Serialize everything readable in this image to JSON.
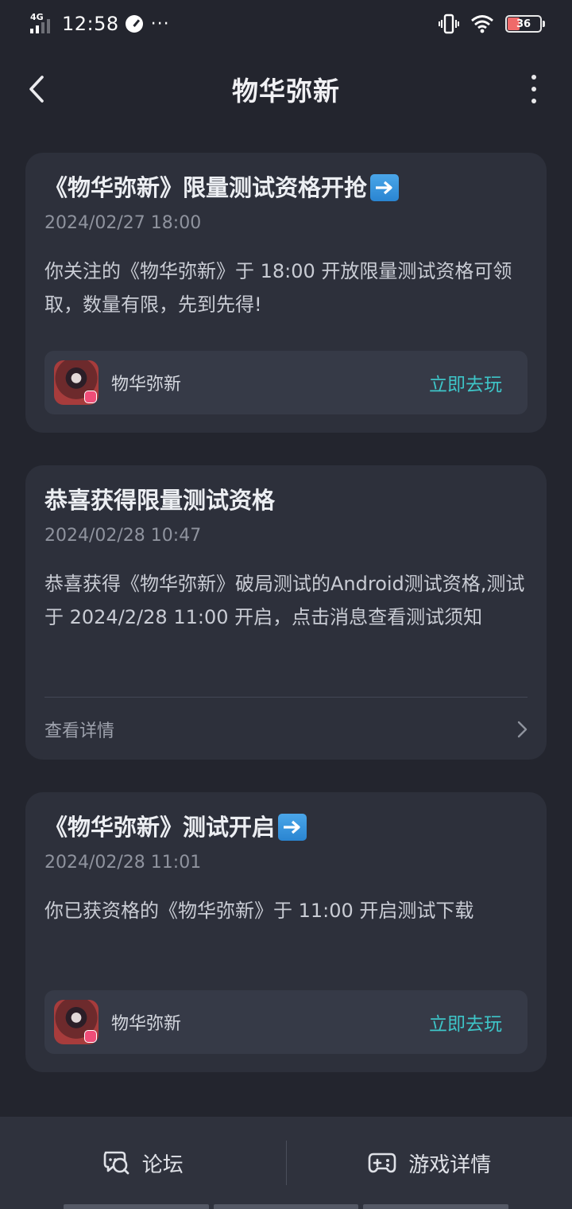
{
  "status_bar": {
    "network": "4G",
    "time": "12:58",
    "more": "···",
    "battery": "36"
  },
  "header": {
    "title": "物华弥新"
  },
  "messages": [
    {
      "title": "《物华弥新》限量测试资格开抢",
      "date": "2024/02/27 18:00",
      "body": "你关注的《物华弥新》于 18:00 开放限量测试资格可领取，数量有限，先到先得!",
      "game_name": "物华弥新",
      "play_label": "立即去玩"
    },
    {
      "title": "恭喜获得限量测试资格",
      "date": "2024/02/28 10:47",
      "body": "恭喜获得《物华弥新》破局测试的Android测试资格,测试于 2024/2/28 11:00 开启，点击消息查看测试须知",
      "details_label": "查看详情"
    },
    {
      "title": "《物华弥新》测试开启",
      "date": "2024/02/28 11:01",
      "body": "你已获资格的《物华弥新》于 11:00 开启测试下载",
      "game_name": "物华弥新",
      "play_label": "立即去玩"
    }
  ],
  "bottom_bar": {
    "forum_label": "论坛",
    "game_details_label": "游戏详情"
  },
  "colors": {
    "background": "#23252e",
    "card": "#2d303b",
    "accent": "#3ec5c8"
  }
}
